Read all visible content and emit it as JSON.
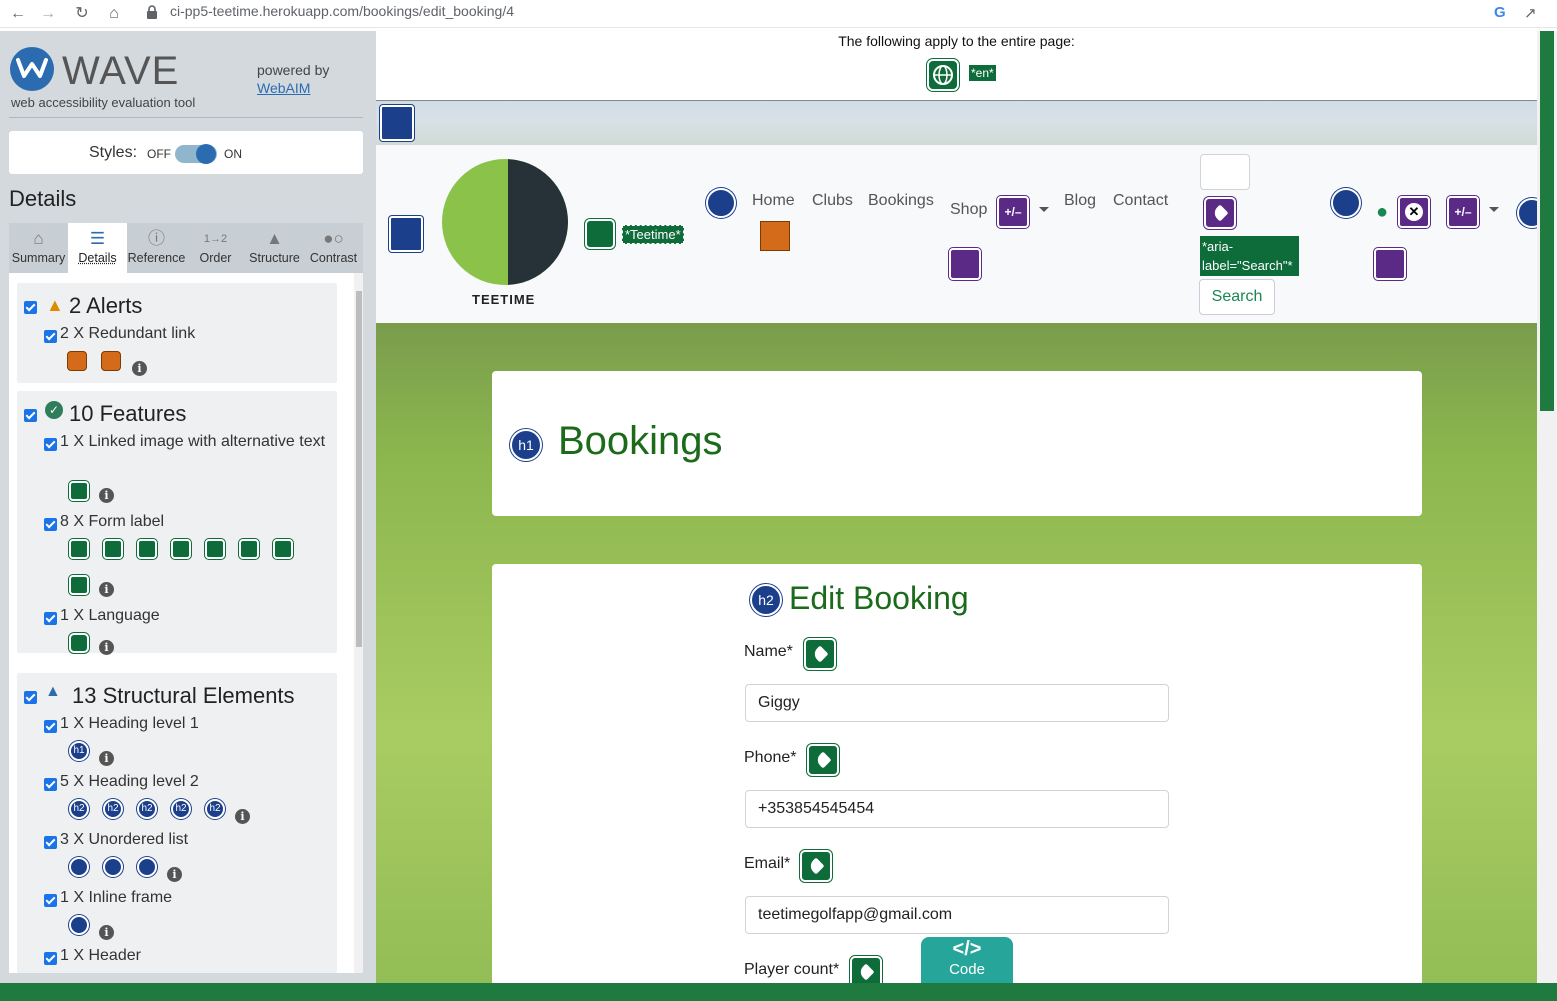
{
  "browser": {
    "url": "ci-pp5-teetime.herokuapp.com/bookings/edit_booking/4"
  },
  "wave": {
    "title": "WAVE",
    "subtitle": "web accessibility evaluation tool",
    "powered_by": "powered by",
    "webaim_link": "WebAIM",
    "styles_label": "Styles:",
    "styles_off": "OFF",
    "styles_on": "ON",
    "details_title": "Details",
    "tabs": [
      {
        "label": "Summary",
        "icon": "home-icon"
      },
      {
        "label": "Details",
        "icon": "list-icon"
      },
      {
        "label": "Reference",
        "icon": "info-icon"
      },
      {
        "label": "Order",
        "icon": "order-icon"
      },
      {
        "label": "Structure",
        "icon": "structure-icon"
      },
      {
        "label": "Contrast",
        "icon": "contrast-icon"
      }
    ],
    "alerts": {
      "heading": "2 Alerts",
      "items": [
        {
          "label": "2 X Redundant link"
        }
      ]
    },
    "features": {
      "heading": "10 Features",
      "items": [
        {
          "label": "1 X Linked image with alternative text"
        },
        {
          "label": "8 X Form label"
        },
        {
          "label": "1 X Language"
        }
      ]
    },
    "structure": {
      "heading": "13 Structural Elements",
      "items": [
        {
          "label": "1 X Heading level 1",
          "badge": "h1"
        },
        {
          "label": "5 X Heading level 2",
          "badge": "h2"
        },
        {
          "label": "3 X Unordered list"
        },
        {
          "label": "1 X Inline frame"
        },
        {
          "label": "1 X Header"
        }
      ]
    }
  },
  "page": {
    "banner_text": "The following apply to the entire page:",
    "lang_badge": "*en*",
    "logo_text": "TEETIME",
    "logo_alt": "*Teetime*",
    "nav": {
      "home": "Home",
      "clubs": "Clubs",
      "bookings": "Bookings",
      "shop": "Shop",
      "blog": "Blog",
      "contact": "Contact",
      "pm_badge": "+/–"
    },
    "aria_label": "*aria-label=\"Search\"*",
    "search_button": "Search",
    "h1_badge": "h1",
    "h1_title": "Bookings",
    "h2_badge": "h2",
    "h2_title": "Edit Booking",
    "form": {
      "name_label": "Name*",
      "name_value": "Giggy",
      "phone_label": "Phone*",
      "phone_value": "+353854545454",
      "email_label": "Email*",
      "email_value": "teetimegolfapp@gmail.com",
      "player_label": "Player count*"
    },
    "code_tab": "Code",
    "code_symbol": "</>"
  }
}
